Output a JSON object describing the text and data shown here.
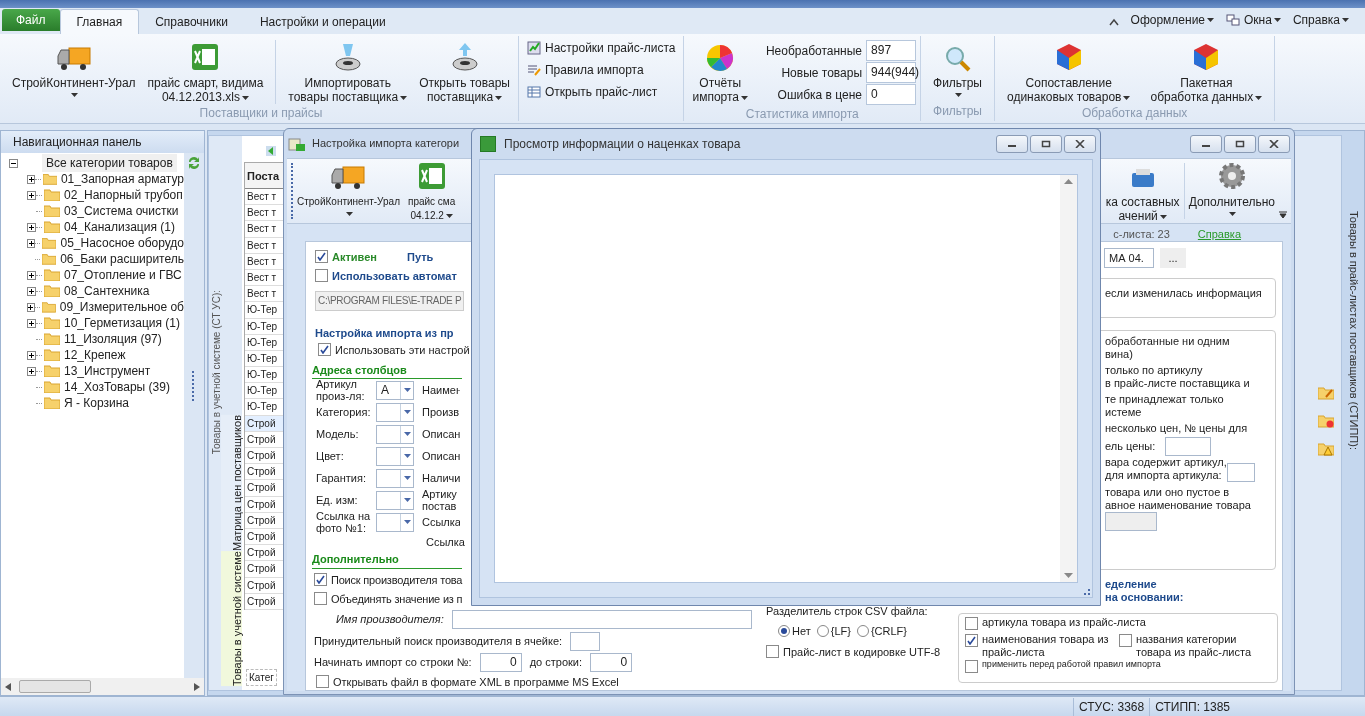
{
  "menu": {
    "file": "Файл",
    "tabs": [
      {
        "label": "Главная",
        "selected": true
      },
      {
        "label": "Справочники",
        "selected": false
      },
      {
        "label": "Настройки и операции",
        "selected": false
      }
    ],
    "right": [
      "Оформление",
      "Окна",
      "Справка"
    ]
  },
  "ribbon": {
    "suppliers": {
      "title": "Поставщики и прайсы",
      "buttons": [
        {
          "kind": "truck",
          "lines": [
            "СтройКонтинент-Урал"
          ]
        },
        {
          "kind": "excel",
          "lines": [
            "прайс смарт, видима",
            "04.12.2013.xls"
          ]
        },
        {
          "kind": "import",
          "lines": [
            "Импортировать",
            "товары поставщика"
          ]
        },
        {
          "kind": "export",
          "lines": [
            "Открыть товары",
            "поставщика"
          ]
        }
      ],
      "links": [
        {
          "kind": "settings",
          "label": "Настройки прайс-листа"
        },
        {
          "kind": "rules",
          "label": "Правила импорта"
        },
        {
          "kind": "sheet",
          "label": "Открыть прайс-лист"
        }
      ]
    },
    "stats": {
      "title": "Статистика импорта",
      "button": [
        "Отчёты",
        "импорта"
      ],
      "rows": [
        {
          "label": "Необработанные",
          "value": "897"
        },
        {
          "label": "Новые товары",
          "value": "944(944)"
        },
        {
          "label": "Ошибка в цене",
          "value": "0"
        }
      ]
    },
    "filters": {
      "title": "Фильтры",
      "button": "Фильтры"
    },
    "processing": {
      "title": "Обработка данных",
      "buttons": [
        [
          "Сопоставление",
          "одинаковых товаров"
        ],
        [
          "Пакетная",
          "обработка данных"
        ]
      ]
    }
  },
  "nav": {
    "title": "Навигационная панель",
    "root": {
      "label": "Все категории товаров",
      "expanded": true,
      "selected": true,
      "children": [
        {
          "label": "01_Запорная арматур",
          "kind": "branch"
        },
        {
          "label": "02_Напорный трубоп",
          "kind": "branch"
        },
        {
          "label": "03_Система очистки",
          "kind": "leaf"
        },
        {
          "label": "04_Канализация (1)",
          "kind": "branch"
        },
        {
          "label": "05_Насосное оборудо",
          "kind": "branch"
        },
        {
          "label": "06_Баки расширитель",
          "kind": "leaf"
        },
        {
          "label": "07_Отопление и ГВС",
          "kind": "branch"
        },
        {
          "label": "08_Сантехника",
          "kind": "branch"
        },
        {
          "label": "09_Измерительное об",
          "kind": "branch"
        },
        {
          "label": "10_Герметизация (1)",
          "kind": "branch"
        },
        {
          "label": "11_Изоляция (97)",
          "kind": "leaf"
        },
        {
          "label": "12_Крепеж",
          "kind": "branch"
        },
        {
          "label": "13_Инструмент",
          "kind": "branch"
        },
        {
          "label": "14_ХозТовары (39)",
          "kind": "leaf"
        },
        {
          "label": "Я - Корзина",
          "kind": "leaf"
        }
      ]
    }
  },
  "back": {
    "caption": "Товары в учетной системе (СТ УС):",
    "tabs": [
      {
        "label": "Матрица цен поставщиков",
        "selected": false
      },
      {
        "label": "Товары в учетной системе",
        "selected": true
      }
    ],
    "table": {
      "columns": [
        "Поста"
      ],
      "rows": [
        {
          "cell": "Вест т",
          "selected": false
        },
        {
          "cell": "Вест т",
          "selected": false
        },
        {
          "cell": "Вест т",
          "selected": false
        },
        {
          "cell": "Вест т",
          "selected": false
        },
        {
          "cell": "Вест т",
          "selected": false
        },
        {
          "cell": "Вест т",
          "selected": false
        },
        {
          "cell": "Вест т",
          "selected": false
        },
        {
          "cell": "Ю-Тер",
          "selected": false
        },
        {
          "cell": "Ю-Тер",
          "selected": false
        },
        {
          "cell": "Ю-Тер",
          "selected": false
        },
        {
          "cell": "Ю-Тер",
          "selected": false
        },
        {
          "cell": "Ю-Тер",
          "selected": false
        },
        {
          "cell": "Ю-Тер",
          "selected": false
        },
        {
          "cell": "Ю-Тер",
          "selected": false
        },
        {
          "cell": "Строй",
          "selected": true
        },
        {
          "cell": "Строй",
          "selected": false
        },
        {
          "cell": "Строй",
          "selected": false
        },
        {
          "cell": "Строй",
          "selected": false
        },
        {
          "cell": "Строй",
          "selected": false
        },
        {
          "cell": "Строй",
          "selected": false
        },
        {
          "cell": "Строй",
          "selected": false
        },
        {
          "cell": "Строй",
          "selected": false
        },
        {
          "cell": "Строй",
          "selected": false
        },
        {
          "cell": "Строй",
          "selected": false
        },
        {
          "cell": "Строй",
          "selected": false
        },
        {
          "cell": "Строй",
          "selected": false
        }
      ]
    },
    "bottom_tab": "Катег",
    "right_caption": "Товары в прайс-листах поставщиков (СТИПП):"
  },
  "import_dialog": {
    "title": "Настройка импорта категори",
    "ribbon_left": [
      {
        "kind": "truck",
        "lines": [
          "СтройКонтинент-Урал"
        ]
      },
      {
        "kind": "excel",
        "lines": [
          "прайс сма",
          "04.12.2"
        ]
      }
    ],
    "ribbon_right": [
      {
        "kind": "box",
        "lines": [
          "ка составных",
          "ачений"
        ]
      },
      {
        "kind": "gear",
        "lines": [
          "Дополнительно"
        ]
      }
    ],
    "active": {
      "label": "Активен",
      "checked": true
    },
    "path_label": "Путь",
    "auto": {
      "label": "Использовать автомат",
      "checked": false
    },
    "path": "C:\\PROGRAM FILES\\E-TRADE P",
    "group_title": "Настройка импорта из пр",
    "use_settings": {
      "label": "Использовать эти настрой",
      "checked": true
    },
    "columns_title": "Адреса столбцов",
    "columns": [
      {
        "label": "Артикул произ-ля:",
        "value": "A",
        "other": "Наимен"
      },
      {
        "label": "Категория:",
        "other": "Произв"
      },
      {
        "label": "Модель:",
        "other": "Описан"
      },
      {
        "label": "Цвет:",
        "other": "Описан"
      },
      {
        "label": "Гарантия:",
        "other": "Наличи"
      },
      {
        "label": "Ед. изм:",
        "other": "Артику постав"
      },
      {
        "label": "Ссылка на фото №1:",
        "other": "Ссылка"
      }
    ],
    "extra_other": "Ссылка",
    "more_title": "Дополнительно",
    "more": [
      {
        "label": "Поиск производителя това",
        "checked": true
      },
      {
        "label": "Объединять значение из п",
        "checked": false
      }
    ],
    "maker_label": "Имя производителя:",
    "force_label": "Принудительный поиск производителя в ячейке:",
    "from_label": "Начинать импорт со строки №:",
    "from": "0",
    "to_label": "до строки:",
    "to": "0",
    "xml": {
      "label": "Открывать файл в формате XML в программе MS Excel",
      "checked": false
    },
    "csv_label": "Разделитель строк CSV файла:",
    "csv": [
      {
        "label": "Нет",
        "selected": true
      },
      {
        "label": "{LF}",
        "selected": false
      },
      {
        "label": "{CRLF}",
        "selected": false
      }
    ],
    "utf8": {
      "label": "Прайс-лист в кодировке UTF-8",
      "checked": false
    },
    "count": "с-листа: 23",
    "help": "Справка",
    "file": "МА 04.",
    "browse": "...",
    "changed": "если изменилась информация",
    "rules": [
      "обработанные ни одним",
      "вина)",
      "только по артикулу",
      "в прайс-листе поставщика и",
      "те принадлежат только",
      "истеме",
      "несколько цен, № цены для"
    ],
    "price_label": "ель цены:",
    "art_lines": [
      "вара содержит артикул,",
      "для импорта артикула:"
    ],
    "name_lines": [
      "товара или оно пустое в",
      "авное наименование товара"
    ],
    "def_title": [
      "еделение",
      "на основании:"
    ],
    "def": [
      {
        "label": "артикула товара из прайс-листа",
        "checked": false
      },
      {
        "label": "наименования товара из прайс-листа",
        "checked": true
      },
      {
        "label": "названия  категории товара из прайс-листа",
        "checked": false
      },
      {
        "label": "применить перед работой правил импорта",
        "checked": false
      }
    ]
  },
  "markup_dialog": {
    "title": "Просмотр информации о наценках товара"
  },
  "status": [
    "СТУС: 3368",
    "СТИПП: 1385"
  ]
}
